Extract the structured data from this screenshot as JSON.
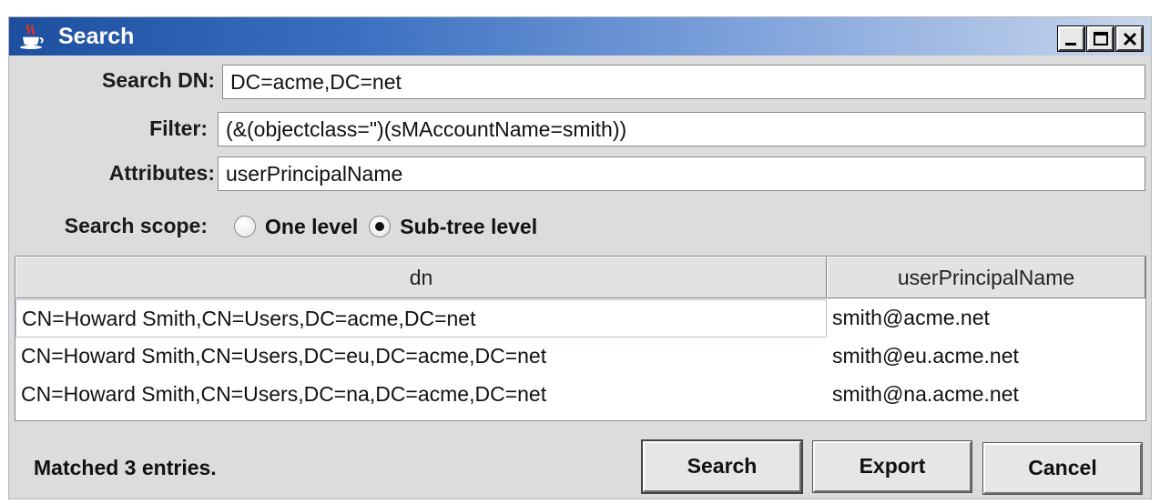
{
  "window": {
    "title": "Search",
    "icon": "java-cup-icon",
    "controls": [
      "minimize-icon",
      "maximize-icon",
      "close-icon"
    ]
  },
  "form": {
    "search_dn": {
      "label": "Search DN:",
      "value": "DC=acme,DC=net"
    },
    "filter": {
      "label": "Filter:",
      "value": "(&(objectclass=\")(sMAccountName=smith))"
    },
    "attributes": {
      "label": "Attributes:",
      "value": "userPrincipalName"
    }
  },
  "scope": {
    "label": "Search scope:",
    "options": [
      {
        "label": "One level",
        "checked": false
      },
      {
        "label": "Sub-tree level",
        "checked": true
      }
    ]
  },
  "table": {
    "columns": [
      "dn",
      "userPrincipalName"
    ],
    "rows": [
      [
        "CN=Howard Smith,CN=Users,DC=acme,DC=net",
        "smith@acme.net"
      ],
      [
        "CN=Howard Smith,CN=Users,DC=eu,DC=acme,DC=net",
        "smith@eu.acme.net"
      ],
      [
        "CN=Howard Smith,CN=Users,DC=na,DC=acme,DC=net",
        "smith@na.acme.net"
      ]
    ]
  },
  "footer": {
    "status": "Matched 3 entries.",
    "search_label": "Search",
    "export_label": "Export",
    "cancel_label": "Cancel"
  }
}
